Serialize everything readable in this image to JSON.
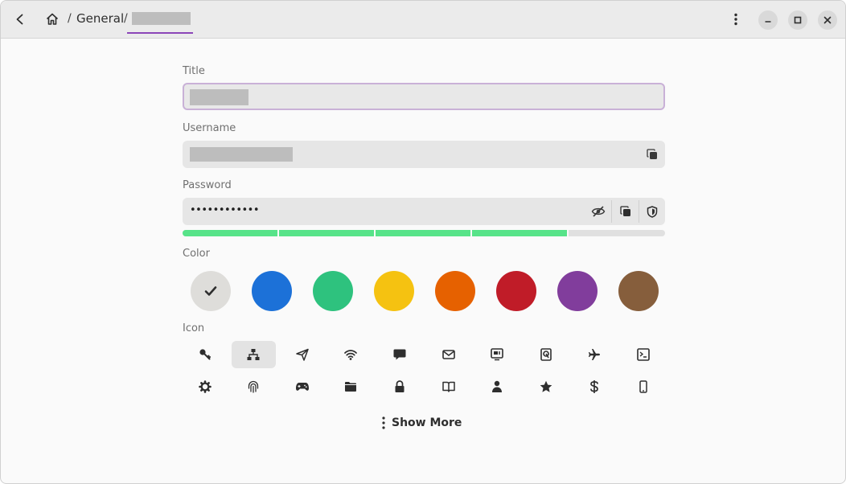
{
  "header": {
    "breadcrumb_sep": "/",
    "breadcrumb_general": "General"
  },
  "form": {
    "title_label": "Title",
    "username_label": "Username",
    "password_label": "Password",
    "password_masked": "••••••••••••",
    "password_strength": 0.8,
    "color_label": "Color",
    "icon_label": "Icon",
    "show_more_label": "Show More"
  },
  "colors": {
    "accent": "#8b46b8",
    "strength": "#57e389",
    "swatches": [
      "#deddda",
      "#1c71d8",
      "#2ec27e",
      "#f5c211",
      "#e66100",
      "#c01c28",
      "#813d9c",
      "#865e3c"
    ],
    "selected_swatch": 0
  },
  "icons": {
    "row1": [
      "key-icon",
      "network-icon",
      "send-icon",
      "wifi-icon",
      "chat-icon",
      "mail-icon",
      "monitor-icon",
      "disk-icon",
      "airplane-icon",
      "terminal-icon"
    ],
    "row2": [
      "gear-icon",
      "fingerprint-icon",
      "gamepad-icon",
      "folder-icon",
      "lock-icon",
      "book-icon",
      "person-icon",
      "star-icon",
      "dollar-icon",
      "phone-icon"
    ],
    "selected": "network-icon"
  }
}
